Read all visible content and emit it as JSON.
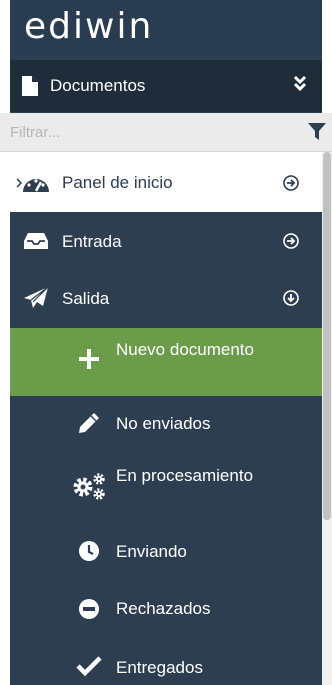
{
  "app": {
    "logo_text": "ediwin"
  },
  "documents_menu": {
    "label": "Documentos"
  },
  "filter": {
    "placeholder": "Filtrar..."
  },
  "nav": [
    {
      "label": "Panel de inicio",
      "icon": "dashboard-icon",
      "arrow": "arrow-circle-right-icon",
      "state": "active"
    },
    {
      "label": "Entrada",
      "icon": "inbox-icon",
      "arrow": "arrow-circle-right-icon"
    },
    {
      "label": "Salida",
      "icon": "send-icon",
      "arrow": "arrow-circle-down-icon",
      "expanded": true
    }
  ],
  "salida_items": [
    {
      "label": "Nuevo documento",
      "icon": "plus-icon",
      "state": "selected"
    },
    {
      "label": "No enviados",
      "icon": "pencil-icon"
    },
    {
      "label": "En procesamiento",
      "icon": "gears-icon"
    },
    {
      "label": "Enviando",
      "icon": "clock-icon"
    },
    {
      "label": "Rechazados",
      "icon": "minus-circle-icon"
    },
    {
      "label": "Entregados",
      "icon": "check-icon"
    }
  ],
  "colors": {
    "sidebar_bg": "#2c3e50",
    "header_bg": "#2a3c4f",
    "documents_bar_bg": "#1f2d3b",
    "selected_bg": "#6b9c4a",
    "active_bg": "#ffffff"
  }
}
